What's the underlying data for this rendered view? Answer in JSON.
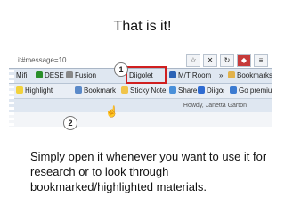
{
  "slide": {
    "title": "That is it!",
    "body": "Simply open it whenever you want to use it for research or to look through bookmarked/highlighted  materials."
  },
  "browser": {
    "address_fragment": "it#message=10",
    "bookmarks_bar": {
      "items": [
        "Mifi",
        "DESE",
        "Fusion",
        "Diigolet",
        "M/T Room"
      ],
      "bookmarks_label": "Bookmarks",
      "more": "»"
    },
    "diigo_toolbar": {
      "items": [
        "Highlight",
        "Bookmark",
        "Sticky Note",
        "Share",
        "Diigo",
        "Go premium!"
      ],
      "more": "»"
    },
    "howdy": "Howdy, Janetta Garton"
  },
  "callouts": {
    "one": "1",
    "two": "2"
  },
  "colors": {
    "accent_red": "#d01f1f",
    "toolbar_blue": "#dfe7f1"
  }
}
